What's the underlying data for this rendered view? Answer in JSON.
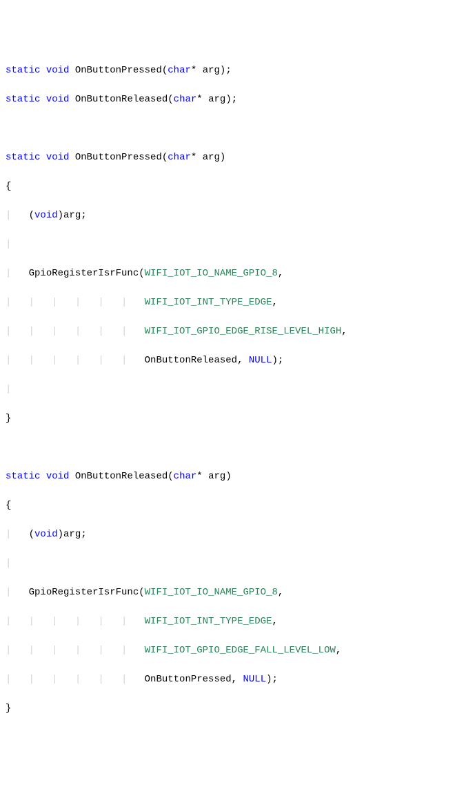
{
  "code": {
    "kw_static": "static",
    "kw_void": "void",
    "kw_char": "char",
    "kw_null": "NULL",
    "func_pressed": "OnButtonPressed",
    "func_released": "OnButtonReleased",
    "func_reg": "GpioRegisterIsrFunc",
    "arg_name": "arg",
    "cast_void_arg": "(",
    "cast_void": "void",
    "cast_void_close": ")arg;",
    "const_gpio8": "WIFI_IOT_IO_NAME_GPIO_8",
    "const_edge": "WIFI_IOT_INT_TYPE_EDGE",
    "const_rise": "WIFI_IOT_GPIO_EDGE_RISE_LEVEL_HIGH",
    "const_fall": "WIFI_IOT_GPIO_EDGE_FALL_LEVEL_LOW",
    "star": "*",
    "lparen": "(",
    "rparen": ")",
    "semi": ";",
    "lbrace": "{",
    "rbrace": "}",
    "comma": ",",
    "decl_suffix_paren_open": "(",
    "decl_suffix_arg": " arg);",
    "space": " ",
    "star_space": "* "
  }
}
